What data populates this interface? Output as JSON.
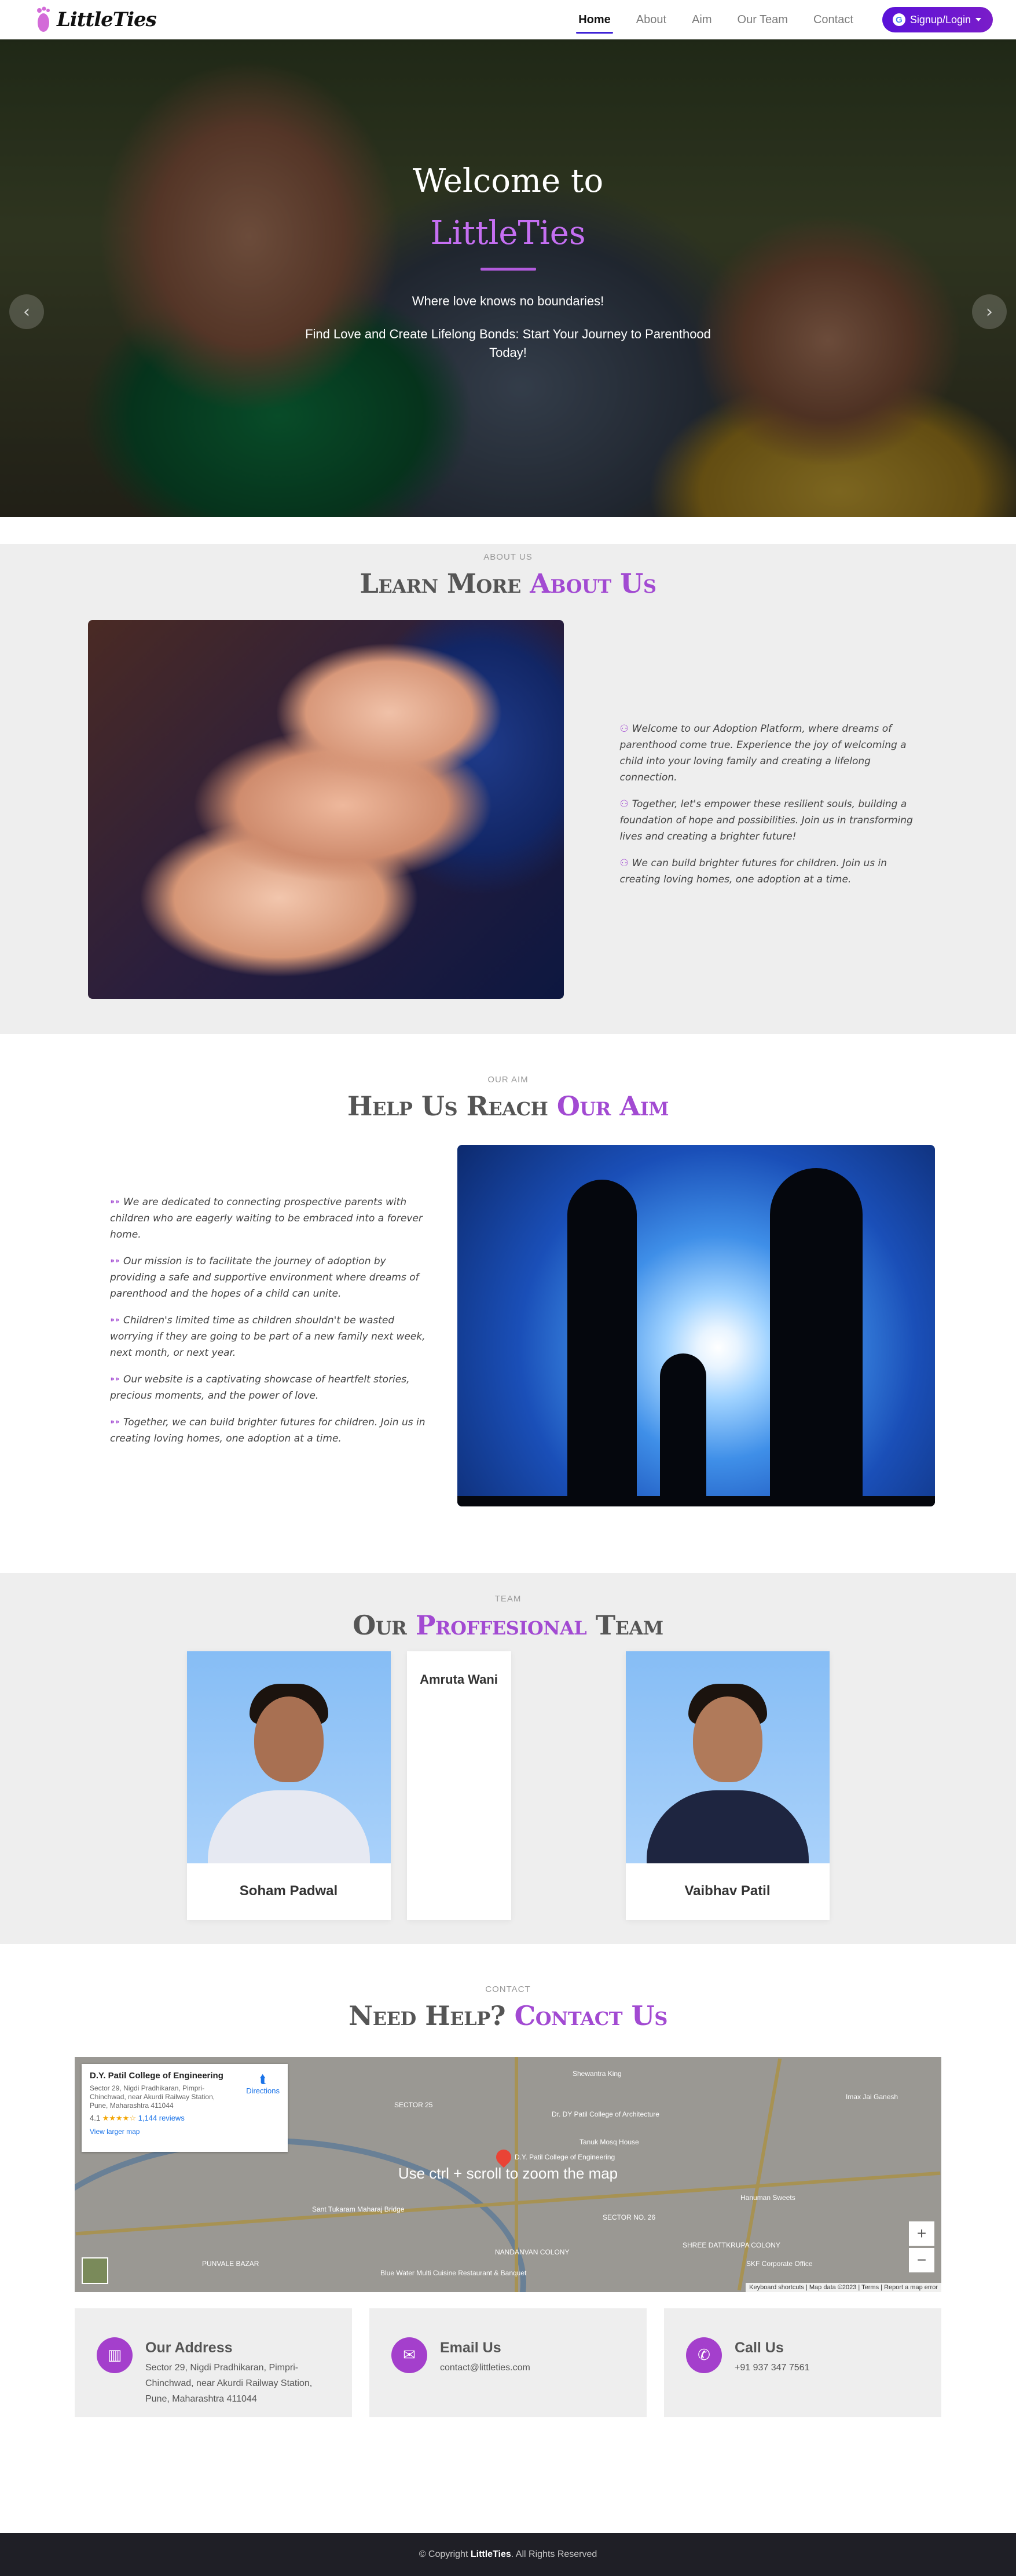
{
  "brand": {
    "name": "LittleTies"
  },
  "nav": {
    "links": [
      "Home",
      "About",
      "Aim",
      "Our Team",
      "Contact"
    ],
    "active": "Home",
    "signup_label": "Signup/Login",
    "google_glyph": "G"
  },
  "hero": {
    "title_line1": "Welcome to",
    "title_line2": "LittleTies",
    "subtitle": "Where love knows no boundaries!",
    "text": "Find Love and Create Lifelong Bonds: Start Your Journey to Parenthood Today!",
    "prev_icon": "‹",
    "next_icon": "›"
  },
  "about": {
    "label": "About Us",
    "title_plain": "Learn More ",
    "title_accent": "About Us",
    "paragraphs": [
      "Welcome to our Adoption Platform, where dreams of parenthood come true. Experience the joy of welcoming a child into your loving family and creating a lifelong connection.",
      "Together, let's empower these resilient souls, building a foundation of hope and possibilities. Join us in transforming lives and creating a brighter future!",
      "We can build brighter futures for children. Join us in creating loving homes, one adoption at a time."
    ]
  },
  "aim": {
    "label": "Our Aim",
    "title_plain": "Help Us Reach ",
    "title_accent": "Our Aim",
    "paragraphs": [
      "We are dedicated to connecting prospective parents with children who are eagerly waiting to be embraced into a forever home.",
      "Our mission is to facilitate the journey of adoption by providing a safe and supportive environment where dreams of parenthood and the hopes of a child can unite.",
      "Children's limited time as children shouldn't be wasted worrying if they are going to be part of a new family next week, next month, or next year.",
      "Our website is a captivating showcase of heartfelt stories, precious moments, and the power of love.",
      "Together, we can build brighter futures for children. Join us in creating loving homes, one adoption at a time."
    ]
  },
  "team": {
    "label": "Team",
    "title_plain1": "Our ",
    "title_accent": "Proffesional",
    "title_plain2": " Team",
    "members": [
      "Soham Padwal",
      "Amruta Wani",
      "Vaibhav Patil"
    ]
  },
  "contact": {
    "label": "Contact",
    "title_plain": "Need Help? ",
    "title_accent": "Contact Us",
    "map": {
      "place_name": "D.Y. Patil College of Engineering",
      "place_address": "Sector 29, Nigdi Pradhikaran, Pimpri-Chinchwad, near Akurdi Railway Station, Pune, Maharashtra 411044",
      "rating": "4.1",
      "stars": "★★★★☆",
      "reviews": "1,144 reviews",
      "larger_map": "View larger map",
      "directions": "Directions",
      "hint": "Use ctrl + scroll to zoom the map",
      "zoom_in": "+",
      "zoom_out": "−",
      "attribution": "Keyboard shortcuts | Map data ©2023 | Terms | Report a map error",
      "pin_label": "D.Y. Patil College of Engineering",
      "labels": [
        "Shewantra King",
        "SECTOR 25",
        "Dr. DY Patil College of Architecture",
        "Tanuk Mosq House",
        "Hanuman Sweets",
        "Sant Tukaram Maharaj Bridge",
        "SECTOR NO. 26",
        "NANDANVAN COLONY",
        "SHREE DATTKRUPA COLONY",
        "SKF Corporate Office",
        "Blue Water Multi Cuisine Restaurant & Banquet",
        "Imax Jai Ganesh",
        "PUNVALE BAZAR"
      ]
    },
    "cards": [
      {
        "title": "Our Address",
        "text": "Sector 29, Nigdi Pradhikaran, Pimpri-Chinchwad, near Akurdi Railway Station, Pune, Maharashtra 411044",
        "icon": "map-icon",
        "glyph": "▥"
      },
      {
        "title": "Email Us",
        "text": "contact@littleties.com",
        "icon": "envelope-icon",
        "glyph": "✉"
      },
      {
        "title": "Call Us",
        "text": "+91 937 347 7561",
        "icon": "phone-icon",
        "glyph": "✆"
      }
    ]
  },
  "footer": {
    "prefix": "© Copyright ",
    "brand": "LittleTies",
    "suffix": ". All Rights Reserved"
  },
  "colors": {
    "accent": "#a24ad2",
    "signup": "#5a12d8",
    "footer": "#1f1f26"
  }
}
